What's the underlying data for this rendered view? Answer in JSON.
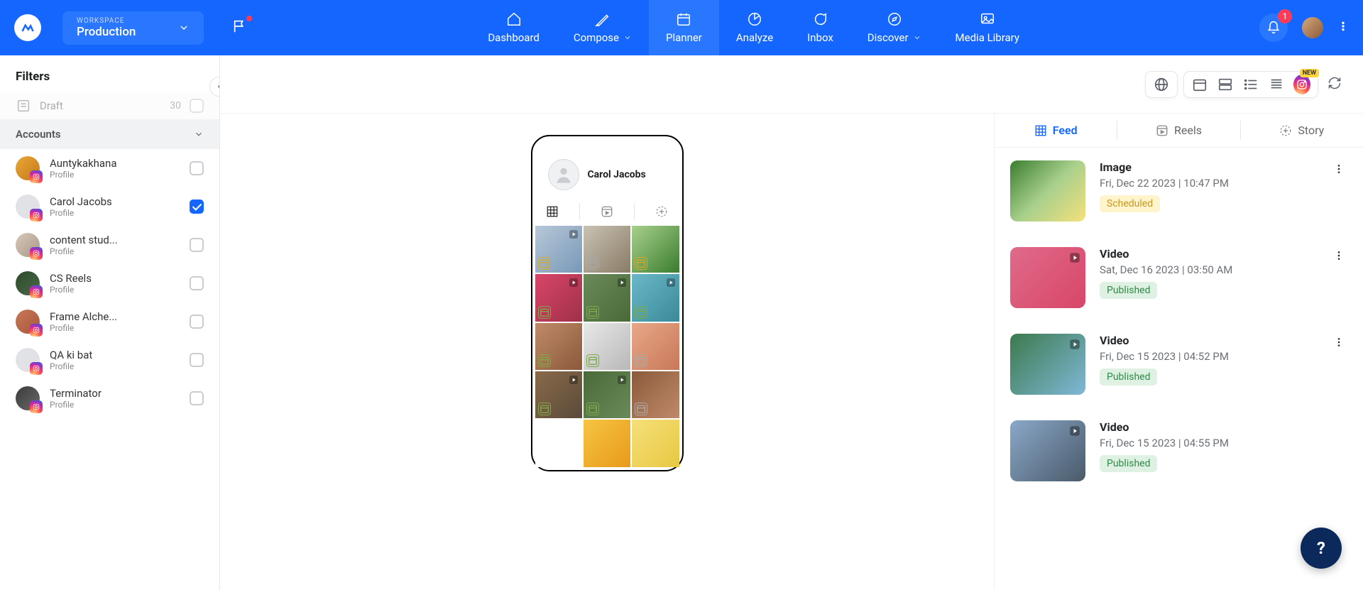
{
  "workspace": {
    "label": "WORKSPACE",
    "name": "Production"
  },
  "nav": {
    "dashboard": "Dashboard",
    "compose": "Compose",
    "planner": "Planner",
    "analyze": "Analyze",
    "inbox": "Inbox",
    "discover": "Discover",
    "media_library": "Media Library"
  },
  "notifications": {
    "count": "1"
  },
  "sidebar": {
    "filters_title": "Filters",
    "status_draft": {
      "label": "Draft",
      "count": "30"
    },
    "accounts_heading": "Accounts",
    "accounts": [
      {
        "name": "Auntykakhana",
        "sub": "Profile",
        "checked": false,
        "avatar": "av-1"
      },
      {
        "name": "Carol Jacobs",
        "sub": "Profile",
        "checked": true,
        "avatar": "av-2"
      },
      {
        "name": "content stud...",
        "sub": "Profile",
        "checked": false,
        "avatar": "av-3"
      },
      {
        "name": "CS Reels",
        "sub": "Profile",
        "checked": false,
        "avatar": "av-4"
      },
      {
        "name": "Frame Alche...",
        "sub": "Profile",
        "checked": false,
        "avatar": "av-5"
      },
      {
        "name": "QA ki bat",
        "sub": "Profile",
        "checked": false,
        "avatar": "av-6"
      },
      {
        "name": "Terminator",
        "sub": "Profile",
        "checked": false,
        "avatar": "av-7"
      }
    ]
  },
  "toolbar_new_tag": "NEW",
  "phone": {
    "profile_name": "Carol Jacobs"
  },
  "right_tabs": {
    "feed": "Feed",
    "reels": "Reels",
    "story": "Story"
  },
  "posts": [
    {
      "type": "Image",
      "date": "Fri, Dec 22 2023 | 10:47 PM",
      "status": "Scheduled",
      "status_class": "scheduled",
      "thumb": "bg-a",
      "video": false,
      "menu": true
    },
    {
      "type": "Video",
      "date": "Sat, Dec 16 2023 | 03:50 AM",
      "status": "Published",
      "status_class": "published",
      "thumb": "bg-b",
      "video": true,
      "menu": true
    },
    {
      "type": "Video",
      "date": "Fri, Dec 15 2023 | 04:52 PM",
      "status": "Published",
      "status_class": "published",
      "thumb": "bg-c",
      "video": true,
      "menu": true
    },
    {
      "type": "Video",
      "date": "Fri, Dec 15 2023 | 04:55 PM",
      "status": "Published",
      "status_class": "published",
      "thumb": "bg-d",
      "video": true,
      "menu": false
    }
  ],
  "grid": [
    {
      "bg": "bg-s",
      "video": true,
      "sched": "yellow"
    },
    {
      "bg": "bg-e",
      "video": false,
      "sched": "gray"
    },
    {
      "bg": "bg-f",
      "video": false,
      "sched": "yellow"
    },
    {
      "bg": "bg-g",
      "video": true,
      "sched": "green"
    },
    {
      "bg": "bg-h",
      "video": true,
      "sched": "green"
    },
    {
      "bg": "bg-i",
      "video": true,
      "sched": "green"
    },
    {
      "bg": "bg-j",
      "video": false,
      "sched": "green"
    },
    {
      "bg": "bg-k",
      "video": false,
      "sched": "green"
    },
    {
      "bg": "bg-l",
      "video": false,
      "sched": "gray"
    },
    {
      "bg": "bg-m",
      "video": true,
      "sched": "green"
    },
    {
      "bg": "bg-n",
      "video": true,
      "sched": "green"
    },
    {
      "bg": "bg-o",
      "video": false,
      "sched": "gray"
    },
    {
      "bg": "bg-p",
      "video": false,
      "sched": ""
    },
    {
      "bg": "bg-q",
      "video": false,
      "sched": ""
    },
    {
      "bg": "bg-r",
      "video": false,
      "sched": ""
    }
  ]
}
